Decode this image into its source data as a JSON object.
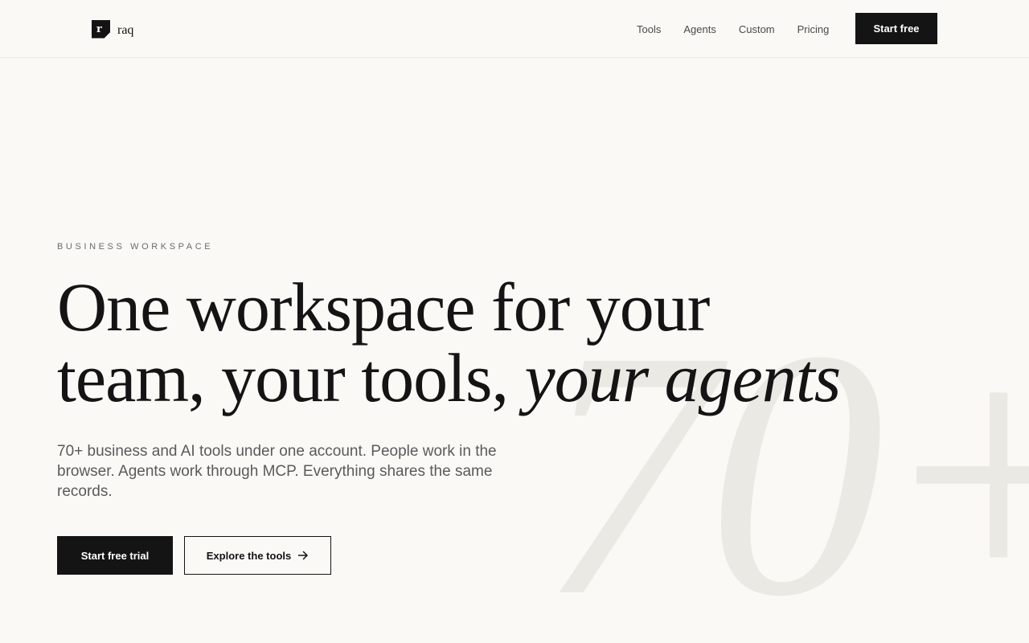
{
  "header": {
    "logo_mark": "r",
    "logo_text": "raq",
    "nav": [
      {
        "label": "Tools"
      },
      {
        "label": "Agents"
      },
      {
        "label": "Custom"
      },
      {
        "label": "Pricing"
      }
    ],
    "cta_label": "Start free"
  },
  "hero": {
    "eyebrow": "BUSINESS WORKSPACE",
    "headline_line1": "One workspace for your",
    "headline_line2": "team, your tools,",
    "headline_italic": "your agents",
    "subtitle": "70+ business and AI tools under one account. People work in the browser. Agents work through MCP. Everything shares the same records.",
    "primary_cta": "Start free trial",
    "secondary_cta": "Explore the tools",
    "background_numeral": "70+"
  },
  "colors": {
    "background": "#faf9f6",
    "text": "#141414",
    "muted": "#5a5a5a",
    "accent_dark": "#141414",
    "numeral": "#ebe9e4"
  },
  "icons": {
    "secondary_cta_icon": "arrow-right-icon"
  }
}
